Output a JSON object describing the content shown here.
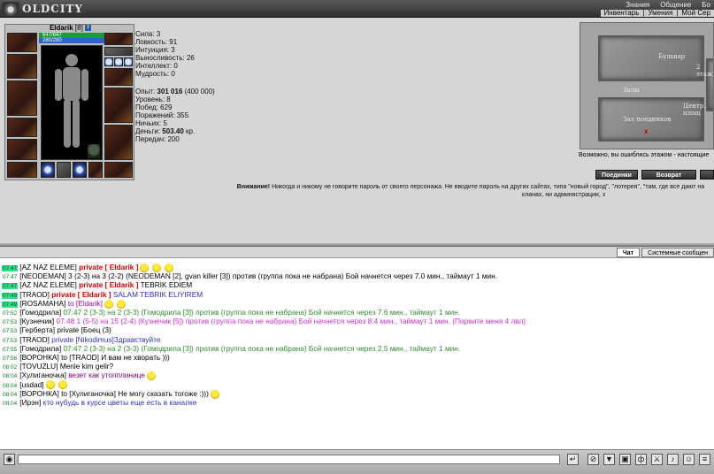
{
  "header": {
    "logo_text": "OLDCITY",
    "menu_row1": [
      "Знания",
      "Общение",
      "Бо"
    ],
    "menu_row2": [
      "Инвентарь",
      "Умения",
      "Мой Сер"
    ]
  },
  "character": {
    "name": "Eldarik",
    "level": "[8]",
    "info_badge": "i",
    "hp": "647/647",
    "mp": "280/280"
  },
  "stats": {
    "strength": "Сила: 3",
    "agility": "Ловкость: 91",
    "intuition": "Интуиция: 3",
    "endurance": "Выносливость: 26",
    "intellect": "Интеллект: 0",
    "wisdom": "Мудрость: 0",
    "exp_label": "Опыт: ",
    "exp_value": "301 016",
    "exp_next": " (400 000)",
    "level": "Уровень: 8",
    "wins": "Побед: 629",
    "losses": "Поражений: 355",
    "draws": "Ничьих: 5",
    "money_label": "Деньги: ",
    "money_value": "503.40",
    "money_unit": " кр.",
    "transfers": "Передач: 200"
  },
  "map": {
    "label_boulevard": "Бульвар",
    "label_halls": "Залы",
    "label_2floor": "2 этаж",
    "label_center": "Центр. площ",
    "label_duel": "Зал поединков",
    "marker": "x",
    "caption": "Возможно, вы ошиблись этажом - настоящие",
    "btn_duels": "Поединки",
    "btn_back": "Возврат"
  },
  "warning": {
    "bold": "Внимание!",
    "text": " Никогда и никому не говорите пароль от своего персонажа. Не вводите пароль на других сайтах, типа \"новый город\", \"лотерея\", \"там, где все дают на",
    "line2": "кланах, ни администрации, з"
  },
  "chat_tabs": [
    "Чат",
    "Системные сообщен"
  ],
  "chat": [
    {
      "time": "07:47",
      "hl": true,
      "parts": [
        {
          "c": "n",
          "t": "[AZ NAZ ELEME]"
        },
        {
          "c": "priv",
          "t": " private [ Eldarik ]"
        }
      ],
      "smiles": 3
    },
    {
      "time": "07:47",
      "hl": false,
      "parts": [
        {
          "c": "n",
          "t": "[NEODEMAN] 3 (2-3) на 3 (2-2) (NEODEMAN [2], gvan killer [3]) против (группа пока не набрана) Бой начнется через 7.0 мин., таймаут 1 мин."
        }
      ],
      "smiles": 0
    },
    {
      "time": "07:47",
      "hl": true,
      "parts": [
        {
          "c": "n",
          "t": "[AZ NAZ ELEME]"
        },
        {
          "c": "priv",
          "t": " private [ Eldarik ]"
        },
        {
          "c": "n",
          "t": " TEBRIK EDIEM"
        }
      ],
      "smiles": 0
    },
    {
      "time": "07:49",
      "hl": true,
      "parts": [
        {
          "c": "n",
          "t": "[TRAOD]"
        },
        {
          "c": "priv",
          "t": " private [ Eldarik ]"
        },
        {
          "c": "blue",
          "t": " SALAM TEBRIK ELIYIREM"
        }
      ],
      "smiles": 0
    },
    {
      "time": "07:49",
      "hl": true,
      "parts": [
        {
          "c": "n",
          "t": "[ROSAMAHA]"
        },
        {
          "c": "pink",
          "t": " to [Eldarik]"
        }
      ],
      "smiles": 2
    },
    {
      "time": "07:52",
      "hl": false,
      "parts": [
        {
          "c": "n",
          "t": "[Гомодрила]"
        },
        {
          "c": "green",
          "t": " 07:47 2 (3-3) на 2 (3-3) (Гомодрила [3]) против (группа пока не набрана) Бой начнется через 7.6 мин., таймаут 1 мин."
        }
      ],
      "smiles": 0
    },
    {
      "time": "07:53",
      "hl": false,
      "parts": [
        {
          "c": "n",
          "t": "[Кузнечик]"
        },
        {
          "c": "pinkbright",
          "t": " 07:48 1 (5-5) на 15 (2-4) (Кузнечик [5]) против (группа пока не набрана) Бой начнется через 8.4 мин., таймаут 1 мин. (Порвите меня 4 лвл)"
        }
      ],
      "smiles": 0
    },
    {
      "time": "07:53",
      "hl": false,
      "parts": [
        {
          "c": "n",
          "t": "[Герберта] private [Боец (3)"
        }
      ],
      "smiles": 0
    },
    {
      "time": "07:53",
      "hl": false,
      "parts": [
        {
          "c": "n",
          "t": "[TRAOD]"
        },
        {
          "c": "blue",
          "t": " private [Nikodimus]Здравствуйте"
        }
      ],
      "smiles": 0
    },
    {
      "time": "07:55",
      "hl": false,
      "parts": [
        {
          "c": "n",
          "t": "[Гомодрила]"
        },
        {
          "c": "green",
          "t": " 07:47 2 (3-3) на 2 (3-3) (Гомодрила [3]) против (группа пока не набрана) Бой начнется через 2.5 мин., таймаут 1 мин."
        }
      ],
      "smiles": 0
    },
    {
      "time": "07:56",
      "hl": false,
      "parts": [
        {
          "c": "n",
          "t": "[ВОРОНКА] to [TRAOD] И вам не хворать )))"
        }
      ],
      "smiles": 0
    },
    {
      "time": "08:02",
      "hl": false,
      "parts": [
        {
          "c": "n",
          "t": "[TOVUZLU] Menle kim gelir?"
        }
      ],
      "smiles": 0
    },
    {
      "time": "08:04",
      "hl": false,
      "parts": [
        {
          "c": "n",
          "t": "[Хулиганочка]"
        },
        {
          "c": "purple",
          "t": " везет как утопплинице"
        }
      ],
      "smiles": 1
    },
    {
      "time": "08:04",
      "hl": false,
      "parts": [
        {
          "c": "n",
          "t": "[usdad]"
        }
      ],
      "smiles": 2
    },
    {
      "time": "08:04",
      "hl": false,
      "parts": [
        {
          "c": "n",
          "t": "[ВОРОНКА] to [Хулиганочка] Не могу сказать тогоже :)))"
        }
      ],
      "smiles": 1
    },
    {
      "time": "08:04",
      "hl": false,
      "parts": [
        {
          "c": "n",
          "t": "[Ирэн]"
        },
        {
          "c": "blue",
          "t": " кто нубудь в курсе цветы еще есть в каналке"
        }
      ],
      "smiles": 0
    }
  ],
  "input": {
    "value": ""
  }
}
